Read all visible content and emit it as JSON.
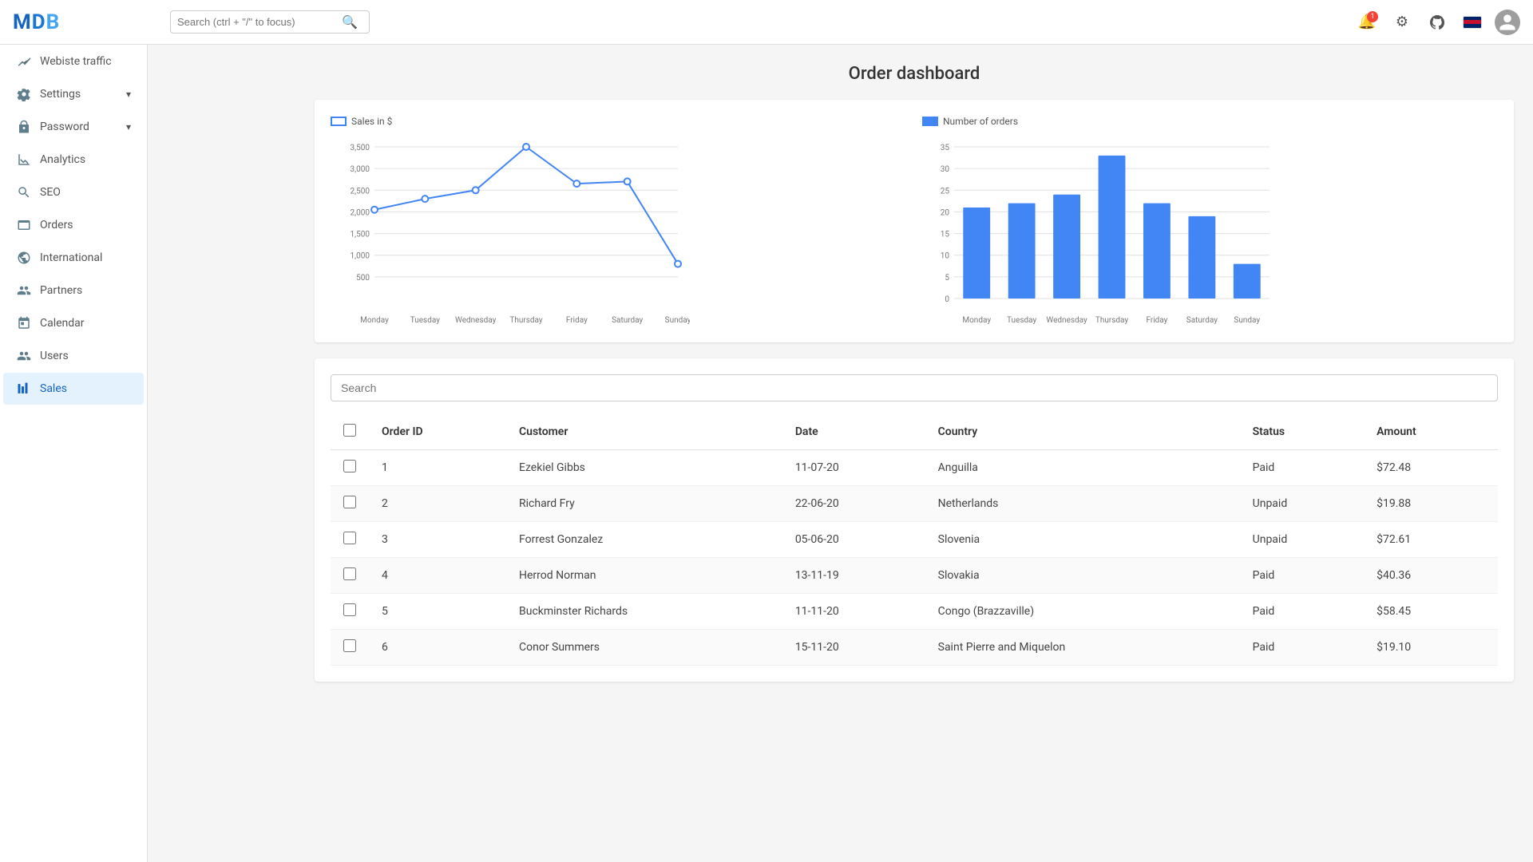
{
  "topbar": {
    "search_placeholder": "Search (ctrl + \"/\" to focus)",
    "icons": {
      "bell": "🔔",
      "settings": "⚙",
      "github": "⬡",
      "flag": "🇬🇧"
    }
  },
  "sidebar": {
    "logo": "MDB",
    "items": [
      {
        "id": "website-traffic",
        "label": "Webiste traffic",
        "icon": "📶",
        "expandable": false,
        "active": false
      },
      {
        "id": "settings",
        "label": "Settings",
        "icon": "⚙",
        "expandable": true,
        "active": false
      },
      {
        "id": "password",
        "label": "Password",
        "icon": "🔒",
        "expandable": true,
        "active": false
      },
      {
        "id": "analytics",
        "label": "Analytics",
        "icon": "📈",
        "expandable": false,
        "active": false
      },
      {
        "id": "seo",
        "label": "SEO",
        "icon": "🔍",
        "expandable": false,
        "active": false
      },
      {
        "id": "orders",
        "label": "Orders",
        "icon": "📋",
        "expandable": false,
        "active": false
      },
      {
        "id": "international",
        "label": "International",
        "icon": "🌐",
        "expandable": false,
        "active": false
      },
      {
        "id": "partners",
        "label": "Partners",
        "icon": "🤝",
        "expandable": false,
        "active": false
      },
      {
        "id": "calendar",
        "label": "Calendar",
        "icon": "📅",
        "expandable": false,
        "active": false
      },
      {
        "id": "users",
        "label": "Users",
        "icon": "👥",
        "expandable": false,
        "active": false
      },
      {
        "id": "sales",
        "label": "Sales",
        "icon": "💼",
        "expandable": false,
        "active": true
      }
    ]
  },
  "page": {
    "title": "Order dashboard"
  },
  "line_chart": {
    "legend": "Sales in $",
    "days": [
      "Monday",
      "Tuesday",
      "Wednesday",
      "Thursday",
      "Friday",
      "Saturday",
      "Sunday"
    ],
    "values": [
      2050,
      2300,
      2500,
      3500,
      2650,
      2700,
      800
    ],
    "y_labels": [
      "500",
      "1,000",
      "1,500",
      "2,000",
      "2,500",
      "3,000",
      "3,500"
    ]
  },
  "bar_chart": {
    "legend": "Number of orders",
    "days": [
      "Monday",
      "Tuesday",
      "Wednesday",
      "Thursday",
      "Friday",
      "Saturday",
      "Sunday"
    ],
    "values": [
      21,
      22,
      24,
      33,
      22,
      19,
      8
    ],
    "y_labels": [
      "0",
      "5",
      "10",
      "15",
      "20",
      "25",
      "30",
      "35"
    ]
  },
  "table_search": {
    "placeholder": "Search"
  },
  "table": {
    "columns": [
      "",
      "Order ID",
      "Customer",
      "Date",
      "Country",
      "Status",
      "Amount"
    ],
    "rows": [
      {
        "id": 1,
        "customer": "Ezekiel Gibbs",
        "date": "11-07-20",
        "country": "Anguilla",
        "status": "Paid",
        "amount": "$72.48"
      },
      {
        "id": 2,
        "customer": "Richard Fry",
        "date": "22-06-20",
        "country": "Netherlands",
        "status": "Unpaid",
        "amount": "$19.88"
      },
      {
        "id": 3,
        "customer": "Forrest Gonzalez",
        "date": "05-06-20",
        "country": "Slovenia",
        "status": "Unpaid",
        "amount": "$72.61"
      },
      {
        "id": 4,
        "customer": "Herrod Norman",
        "date": "13-11-19",
        "country": "Slovakia",
        "status": "Paid",
        "amount": "$40.36"
      },
      {
        "id": 5,
        "customer": "Buckminster Richards",
        "date": "11-11-20",
        "country": "Congo (Brazzaville)",
        "status": "Paid",
        "amount": "$58.45"
      },
      {
        "id": 6,
        "customer": "Conor Summers",
        "date": "15-11-20",
        "country": "Saint Pierre and Miquelon",
        "status": "Paid",
        "amount": "$19.10"
      }
    ]
  }
}
